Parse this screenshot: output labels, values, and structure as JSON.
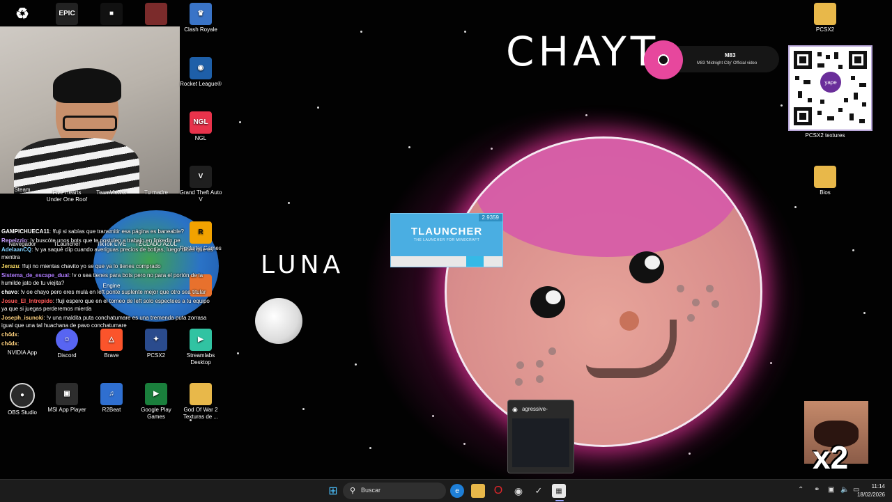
{
  "desktop_icons": [
    {
      "label": "",
      "glyph": "♻",
      "color": "#3b6fb3"
    },
    {
      "label": "",
      "glyph": "EPIC",
      "color": "#222222"
    },
    {
      "label": "",
      "glyph": "■",
      "color": "#111111"
    },
    {
      "label": "",
      "glyph": "",
      "color": "#7b2b2b"
    },
    {
      "label": "Clash Royale",
      "glyph": "♛",
      "color": "#3a74c7"
    },
    {
      "label": "Rocket League®",
      "glyph": "◉",
      "color": "#1e5fa8"
    },
    {
      "label": "NGL",
      "glyph": "NGL",
      "color": "#e8334b"
    },
    {
      "label": "Grand Theft Auto V",
      "glyph": "V",
      "color": "#1f1f1f"
    },
    {
      "label": "Rockstar Games",
      "glyph": "R",
      "color": "#f2a200"
    },
    {
      "label": "Streamlabs Desktop",
      "glyph": "▶",
      "color": "#31c3a2"
    },
    {
      "label": "Discord",
      "glyph": "☺",
      "color": "#5865f2"
    },
    {
      "label": "Brave",
      "glyph": "△",
      "color": "#fb542b"
    },
    {
      "label": "PCSX2",
      "glyph": "✦",
      "color": "#2a4b8d"
    },
    {
      "label": "OBS Studio",
      "glyph": "●",
      "color": "#2a2a2a"
    },
    {
      "label": "MSI App Player",
      "glyph": "▣",
      "color": "#2d2d2d"
    },
    {
      "label": "R2Beat",
      "glyph": "♫",
      "color": "#2f6fd0"
    },
    {
      "label": "Google Play Games",
      "glyph": "▶",
      "color": "#1a7f3c"
    },
    {
      "label": "God Of War 2 Texturas de ...",
      "glyph": "",
      "color": "#e8b84a"
    },
    {
      "label": "PCSX2",
      "glyph": "",
      "color": "#e8b84a"
    },
    {
      "label": "PCSX2 textures",
      "glyph": "",
      "color": "#e8b84a"
    },
    {
      "label": "Bios",
      "glyph": "",
      "color": "#e8b84a"
    },
    {
      "label": "Steam",
      "glyph": "",
      "color": "#1b2838"
    },
    {
      "label": "Five Hearts Under One Roof",
      "glyph": "",
      "color": "#a0522d"
    },
    {
      "label": "TeamViewer",
      "glyph": "",
      "color": "#0e8ee9"
    },
    {
      "label": "Tu madre",
      "glyph": "",
      "color": "#444444"
    },
    {
      "label": "Navegador",
      "glyph": "",
      "color": "#aa1a1a"
    },
    {
      "label": "TLauncher",
      "glyph": "",
      "color": "#4aaee2"
    },
    {
      "label": "TikTok LIVE",
      "glyph": "",
      "color": "#111111"
    },
    {
      "label": "TECLADO AZUL",
      "glyph": "",
      "color": "#e8b84a"
    },
    {
      "label": "Engine",
      "glyph": "",
      "color": "#555555"
    },
    {
      "label": "NVIDIA App",
      "glyph": "",
      "color": "#76b900"
    }
  ],
  "chat": [
    {
      "user": "GAMPICHUECA11",
      "user_color": "#ffffff",
      "text": ": !fuji si sabías que transmitir esa página es baneable?"
    },
    {
      "user": "Repeizzio",
      "user_color": "#c9a0ff",
      "text": ": !v buscóte unos bots que te postulen a trabajo en linkedin pe"
    },
    {
      "user": "AdelaanCQ",
      "user_color": "#7fd1ff",
      "text": ": !v ya saqué clip cuando averiguas precios de botijas, luego dices que es mentira"
    },
    {
      "user": "Jerazu",
      "user_color": "#ffe066",
      "text": ": !fuji no mientas chavito yo se que ya lo tienes comprado"
    },
    {
      "user": "Sistema_de_escape_dual",
      "user_color": "#b07cff",
      "text": ": !v o sea tienes para bots pero no para el portón de la humilde jato de tu viejita?"
    },
    {
      "user": "chavo",
      "user_color": "#ffffff",
      "text": ": !v oe chayo pero eres mulá en left ponte suplente mejor que otro sea titular"
    },
    {
      "user": "Josue_El_Intrepido",
      "user_color": "#ff5a5a",
      "text": ": !fuji espero que en el torneo de left solo espectees a tu equipo ya que si juegas perderemos mierda"
    },
    {
      "user": "Joseph_isunoki",
      "user_color": "#ffd27f",
      "text": ": !v una maldita puta conchatumare es una tremenda puta zorrasa igual que una tal huachana de pavo conchatumare"
    },
    {
      "user": "ch4dx",
      "user_color": "#ffd27f",
      "text": ":"
    },
    {
      "user": "ch4dx",
      "user_color": "#ffd27f",
      "text": ":"
    }
  ],
  "drawing": {
    "title": "CHAYT",
    "moon_label": "LUNA"
  },
  "tlauncher": {
    "version": "2.9359",
    "name": "TLAUNCHER",
    "subtitle": "THE LAUNCHER FOR MINECRAFT",
    "progress": 0.17
  },
  "music": {
    "artist": "M83",
    "track": "M83 'Midnight City' Official video"
  },
  "qr": {
    "brand": "yape"
  },
  "thumbnail": {
    "title": "agressive-"
  },
  "meme": {
    "text": "x2"
  },
  "taskbar": {
    "search_placeholder": "Buscar",
    "time": "11:14",
    "date": "18/02/2026",
    "pinned": [
      "windows-icon",
      "edge-icon",
      "folder-icon",
      "opera-icon",
      "obs-icon",
      "steam-icon",
      "app-icon"
    ]
  }
}
